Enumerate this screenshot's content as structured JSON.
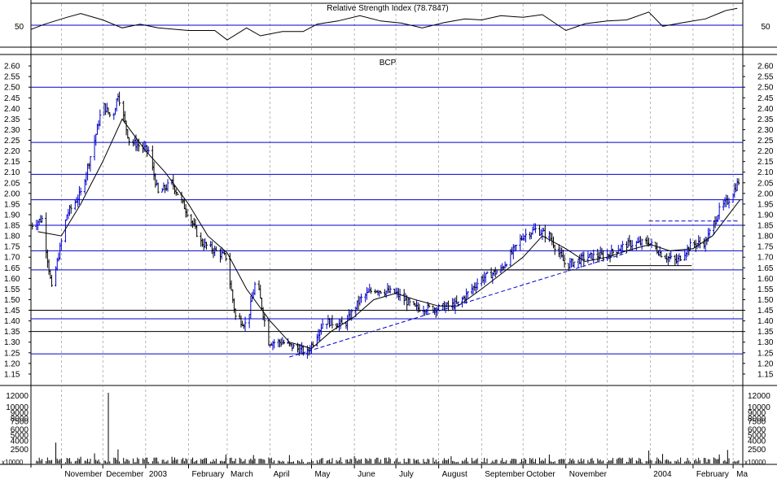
{
  "chart_data": {
    "type": "ohlc-bar",
    "title": "BCP",
    "colors": {
      "up_bar": "#0000cc",
      "down_bar": "#000000",
      "moving_average": "#000000",
      "horizontal_level": "#0000cc",
      "horizontal_level_dark": "#000000",
      "trendline": "#0000cc",
      "grid": "#888888"
    },
    "x_axis": {
      "labels": [
        "November",
        "December",
        "2003",
        "February",
        "March",
        "April",
        "May",
        "June",
        "July",
        "August",
        "September",
        "October",
        "November",
        "",
        "2004",
        "February",
        "Ma"
      ],
      "range": [
        "2002-10-10",
        "2004-03-08"
      ]
    },
    "rsi_panel": {
      "title": "Relative Strength Index (78.7847)",
      "y_tick": "50",
      "ylim": [
        20,
        100
      ],
      "series": [
        [
          "2002-10-10",
          52
        ],
        [
          "2002-10-20",
          62
        ],
        [
          "2002-11-05",
          75
        ],
        [
          "2002-11-15",
          82
        ],
        [
          "2002-12-01",
          70
        ],
        [
          "2002-12-15",
          55
        ],
        [
          "2002-12-28",
          62
        ],
        [
          "2003-01-10",
          55
        ],
        [
          "2003-02-01",
          50
        ],
        [
          "2003-02-20",
          50
        ],
        [
          "2003-03-01",
          32
        ],
        [
          "2003-03-15",
          55
        ],
        [
          "2003-03-25",
          40
        ],
        [
          "2003-04-10",
          48
        ],
        [
          "2003-04-25",
          48
        ],
        [
          "2003-05-05",
          62
        ],
        [
          "2003-05-20",
          68
        ],
        [
          "2003-06-05",
          78
        ],
        [
          "2003-06-20",
          68
        ],
        [
          "2003-07-05",
          64
        ],
        [
          "2003-07-20",
          55
        ],
        [
          "2003-08-05",
          65
        ],
        [
          "2003-08-20",
          72
        ],
        [
          "2003-09-01",
          70
        ],
        [
          "2003-09-15",
          78
        ],
        [
          "2003-10-01",
          75
        ],
        [
          "2003-10-15",
          80
        ],
        [
          "2003-11-01",
          50
        ],
        [
          "2003-11-15",
          63
        ],
        [
          "2003-12-01",
          68
        ],
        [
          "2003-12-15",
          70
        ],
        [
          "2003-12-31",
          85
        ],
        [
          "2004-01-10",
          58
        ],
        [
          "2004-01-25",
          65
        ],
        [
          "2004-02-10",
          72
        ],
        [
          "2004-02-25",
          88
        ],
        [
          "2004-03-04",
          92
        ]
      ]
    },
    "price_panel": {
      "ylim": [
        1.1,
        2.65
      ],
      "y_ticks": [
        1.15,
        1.2,
        1.25,
        1.3,
        1.35,
        1.4,
        1.45,
        1.5,
        1.55,
        1.6,
        1.65,
        1.7,
        1.75,
        1.8,
        1.85,
        1.9,
        1.95,
        2.0,
        2.05,
        2.1,
        2.15,
        2.2,
        2.25,
        2.3,
        2.35,
        2.4,
        2.45,
        2.5,
        2.55,
        2.6
      ],
      "horizontal_levels": [
        {
          "value": 2.5,
          "color": "#0000cc"
        },
        {
          "value": 2.24,
          "color": "#0000cc"
        },
        {
          "value": 2.09,
          "color": "#0000cc"
        },
        {
          "value": 1.97,
          "color": "#0000cc"
        },
        {
          "value": 1.85,
          "color": "#0000cc"
        },
        {
          "value": 1.73,
          "color": "#0000cc"
        },
        {
          "value": 1.64,
          "color": "#0000cc"
        },
        {
          "value": 1.45,
          "color": "#000000"
        },
        {
          "value": 1.41,
          "color": "#0000cc"
        },
        {
          "value": 1.35,
          "color": "#000000"
        },
        {
          "value": 1.245,
          "color": "#0000cc"
        }
      ],
      "trendlines": [
        {
          "from": [
            "2003-04-15",
            1.23
          ],
          "to": [
            "2003-12-15",
            1.72
          ]
        },
        {
          "from": [
            "2003-12-31",
            1.87
          ],
          "to": [
            "2004-03-06",
            1.87
          ]
        }
      ],
      "support_lines": [
        {
          "from": [
            "2003-03-10",
            1.64
          ],
          "to": [
            "2004-01-31",
            1.64
          ]
        },
        {
          "from": [
            "2003-12-01",
            1.66
          ],
          "to": [
            "2004-01-31",
            1.66
          ]
        }
      ],
      "close_path": [
        [
          "2002-10-10",
          1.85
        ],
        [
          "2002-10-18",
          1.88
        ],
        [
          "2002-10-25",
          1.55
        ],
        [
          "2002-11-05",
          1.9
        ],
        [
          "2002-11-15",
          2.0
        ],
        [
          "2002-11-25",
          2.25
        ],
        [
          "2002-12-01",
          2.42
        ],
        [
          "2002-12-08",
          2.35
        ],
        [
          "2002-12-12",
          2.47
        ],
        [
          "2002-12-20",
          2.25
        ],
        [
          "2003-01-03",
          2.2
        ],
        [
          "2003-01-10",
          2.0
        ],
        [
          "2003-01-20",
          2.05
        ],
        [
          "2003-02-01",
          1.9
        ],
        [
          "2003-02-10",
          1.77
        ],
        [
          "2003-02-20",
          1.73
        ],
        [
          "2003-02-28",
          1.7
        ],
        [
          "2003-03-07",
          1.42
        ],
        [
          "2003-03-15",
          1.38
        ],
        [
          "2003-03-22",
          1.6
        ],
        [
          "2003-03-31",
          1.3
        ],
        [
          "2003-04-10",
          1.3
        ],
        [
          "2003-04-20",
          1.27
        ],
        [
          "2003-04-28",
          1.25
        ],
        [
          "2003-05-10",
          1.4
        ],
        [
          "2003-05-25",
          1.38
        ],
        [
          "2003-06-05",
          1.5
        ],
        [
          "2003-06-15",
          1.55
        ],
        [
          "2003-07-01",
          1.53
        ],
        [
          "2003-07-15",
          1.46
        ],
        [
          "2003-08-01",
          1.46
        ],
        [
          "2003-08-15",
          1.48
        ],
        [
          "2003-09-01",
          1.6
        ],
        [
          "2003-09-15",
          1.64
        ],
        [
          "2003-10-01",
          1.8
        ],
        [
          "2003-10-10",
          1.83
        ],
        [
          "2003-10-20",
          1.8
        ],
        [
          "2003-11-01",
          1.66
        ],
        [
          "2003-11-15",
          1.7
        ],
        [
          "2003-12-01",
          1.71
        ],
        [
          "2003-12-15",
          1.76
        ],
        [
          "2003-12-31",
          1.77
        ],
        [
          "2004-01-10",
          1.71
        ],
        [
          "2004-01-20",
          1.68
        ],
        [
          "2004-01-31",
          1.76
        ],
        [
          "2004-02-10",
          1.77
        ],
        [
          "2004-02-20",
          1.92
        ],
        [
          "2004-02-28",
          1.98
        ],
        [
          "2004-03-06",
          2.07
        ]
      ],
      "moving_average": [
        [
          "2002-10-15",
          1.82
        ],
        [
          "2002-11-01",
          1.8
        ],
        [
          "2002-11-15",
          1.95
        ],
        [
          "2002-12-01",
          2.15
        ],
        [
          "2002-12-15",
          2.35
        ],
        [
          "2003-01-01",
          2.2
        ],
        [
          "2003-01-15",
          2.1
        ],
        [
          "2003-02-01",
          1.95
        ],
        [
          "2003-02-15",
          1.8
        ],
        [
          "2003-03-01",
          1.72
        ],
        [
          "2003-03-15",
          1.55
        ],
        [
          "2003-04-01",
          1.4
        ],
        [
          "2003-04-15",
          1.3
        ],
        [
          "2003-05-01",
          1.27
        ],
        [
          "2003-05-15",
          1.35
        ],
        [
          "2003-06-01",
          1.42
        ],
        [
          "2003-06-15",
          1.5
        ],
        [
          "2003-07-01",
          1.53
        ],
        [
          "2003-07-15",
          1.5
        ],
        [
          "2003-08-01",
          1.47
        ],
        [
          "2003-08-15",
          1.47
        ],
        [
          "2003-09-01",
          1.55
        ],
        [
          "2003-09-15",
          1.62
        ],
        [
          "2003-10-01",
          1.7
        ],
        [
          "2003-10-15",
          1.8
        ],
        [
          "2003-11-01",
          1.74
        ],
        [
          "2003-11-15",
          1.68
        ],
        [
          "2003-12-01",
          1.7
        ],
        [
          "2003-12-15",
          1.73
        ],
        [
          "2004-01-01",
          1.76
        ],
        [
          "2004-01-15",
          1.73
        ],
        [
          "2004-02-01",
          1.74
        ],
        [
          "2004-02-15",
          1.8
        ],
        [
          "2004-03-06",
          1.97
        ]
      ]
    },
    "volume_panel": {
      "ylim": [
        0,
        13500
      ],
      "y_ticks": [
        2500,
        4000,
        5000,
        6000,
        7500,
        8000,
        9000,
        10000,
        12000
      ],
      "unit_label": "x10000",
      "spikes": [
        [
          "2002-10-28",
          3700
        ],
        [
          "2002-11-15",
          1200
        ],
        [
          "2002-11-25",
          1800
        ],
        [
          "2002-12-05",
          12500
        ],
        [
          "2002-12-12",
          2500
        ],
        [
          "2003-01-20",
          1200
        ],
        [
          "2003-02-28",
          1600
        ],
        [
          "2003-03-20",
          1500
        ],
        [
          "2003-04-15",
          1500
        ],
        [
          "2003-06-01",
          1300
        ],
        [
          "2003-08-10",
          1300
        ],
        [
          "2003-10-20",
          1600
        ],
        [
          "2003-12-31",
          2300
        ],
        [
          "2004-01-10",
          1700
        ],
        [
          "2004-02-20",
          1600
        ],
        [
          "2004-02-26",
          2400
        ]
      ]
    }
  }
}
